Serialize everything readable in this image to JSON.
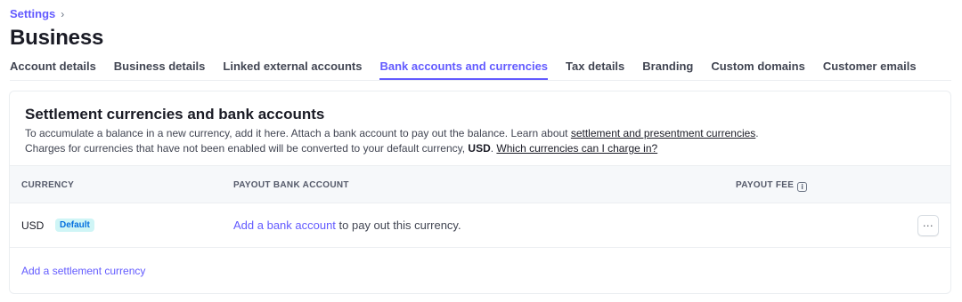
{
  "breadcrumb": {
    "parent": "Settings",
    "separator_icon": "chevron-right-icon"
  },
  "page": {
    "title": "Business"
  },
  "tabs": [
    {
      "label": "Account details",
      "active": false
    },
    {
      "label": "Business details",
      "active": false
    },
    {
      "label": "Linked external accounts",
      "active": false
    },
    {
      "label": "Bank accounts and currencies",
      "active": true
    },
    {
      "label": "Tax details",
      "active": false
    },
    {
      "label": "Branding",
      "active": false
    },
    {
      "label": "Custom domains",
      "active": false
    },
    {
      "label": "Customer emails",
      "active": false
    }
  ],
  "card": {
    "title": "Settlement currencies and bank accounts",
    "line1_text": "To accumulate a balance in a new currency, add it here. Attach a bank account to pay out the balance. Learn about ",
    "line1_link": "settlement and presentment currencies",
    "line1_end": ".",
    "line2_text": "Charges for currencies that have not been enabled will be converted to your default currency, ",
    "line2_bold": "USD",
    "line2_mid": ". ",
    "line2_link": "Which currencies can I charge in?"
  },
  "table": {
    "headers": {
      "currency": "CURRENCY",
      "payout_bank_account": "PAYOUT BANK ACCOUNT",
      "payout_fee": "PAYOUT FEE"
    },
    "info_icon_glyph": "i",
    "rows": [
      {
        "currency": "USD",
        "badge": "Default",
        "payout_link": "Add a bank account",
        "payout_text": " to pay out this currency.",
        "more_glyph": "···"
      }
    ]
  },
  "actions": {
    "add_currency": "Add a settlement currency"
  },
  "colors": {
    "accent": "#635bff",
    "badge_bg": "#cff5f6",
    "badge_text": "#0570de"
  }
}
